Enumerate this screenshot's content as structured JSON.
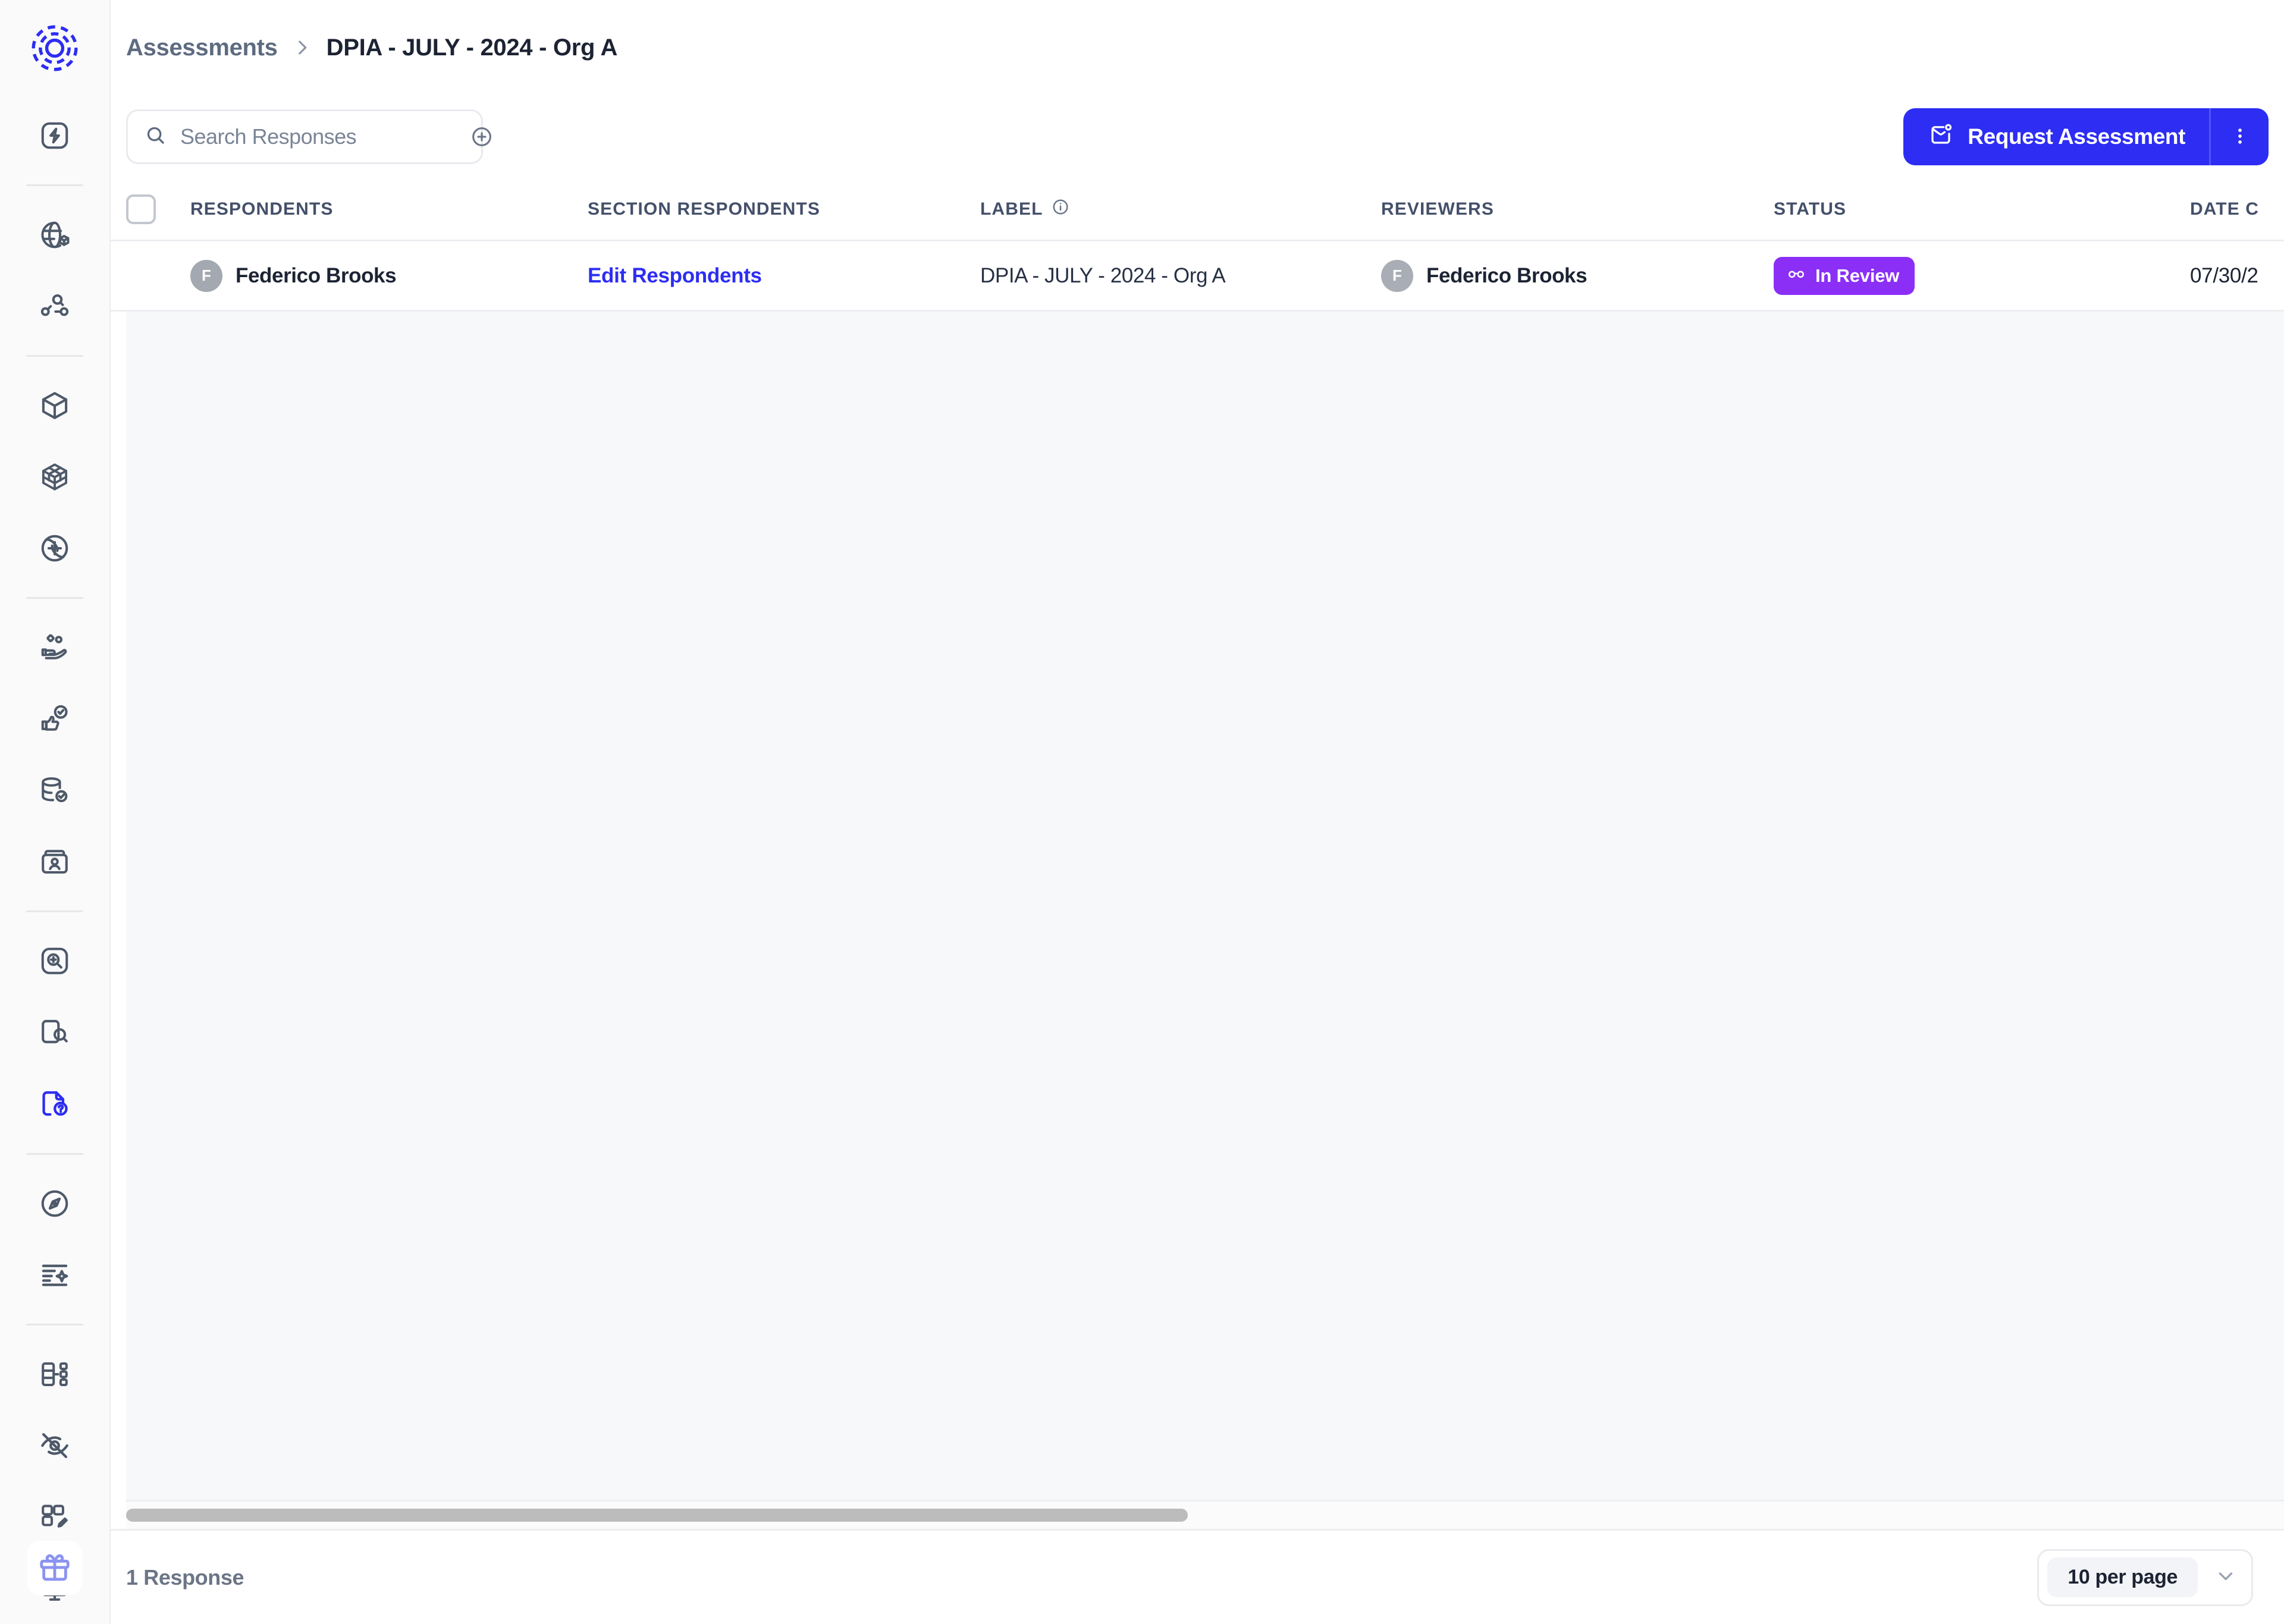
{
  "brand": {
    "logo_icon": "concentric-dashed-circle-logo",
    "accent_blue": "#2d2df3",
    "accent_purple": "#8b2ff7",
    "icon_gray": "#4e5969",
    "gift_color": "#8b93f0"
  },
  "sidebar": {
    "groups": [
      {
        "items": [
          {
            "icon": "lightning-square-icon",
            "name": "sidebar-item-automation",
            "active": false
          }
        ]
      },
      {
        "items": [
          {
            "icon": "globe-box-icon",
            "name": "sidebar-item-global-inventory",
            "active": false
          },
          {
            "icon": "network-search-icon",
            "name": "sidebar-item-data-discovery",
            "active": false
          }
        ]
      },
      {
        "items": [
          {
            "icon": "cube-icon",
            "name": "sidebar-item-assets",
            "active": false
          },
          {
            "icon": "grid-cube-icon",
            "name": "sidebar-item-systems",
            "active": false
          },
          {
            "icon": "globe-network-icon",
            "name": "sidebar-item-vendors",
            "active": false
          }
        ]
      },
      {
        "items": [
          {
            "icon": "hand-data-icon",
            "name": "sidebar-item-data-subjects",
            "active": false
          },
          {
            "icon": "thumbs-up-check-icon",
            "name": "sidebar-item-consent",
            "active": false
          },
          {
            "icon": "database-check-icon",
            "name": "sidebar-item-data-mapping",
            "active": false
          },
          {
            "icon": "contact-card-icon",
            "name": "sidebar-item-records",
            "active": false
          }
        ]
      },
      {
        "items": [
          {
            "icon": "search-zoom-square-icon",
            "name": "sidebar-item-scanning",
            "active": false
          },
          {
            "icon": "document-search-icon",
            "name": "sidebar-item-document-review",
            "active": false
          },
          {
            "icon": "document-question-icon",
            "name": "sidebar-item-assessments",
            "active": true
          }
        ]
      },
      {
        "items": [
          {
            "icon": "compass-icon",
            "name": "sidebar-item-navigator",
            "active": false
          },
          {
            "icon": "list-sparkle-icon",
            "name": "sidebar-item-ai-summary",
            "active": false
          }
        ]
      },
      {
        "items": [
          {
            "icon": "workflow-icon",
            "name": "sidebar-item-workflows",
            "active": false
          },
          {
            "icon": "eye-off-icon",
            "name": "sidebar-item-privacy",
            "active": false
          },
          {
            "icon": "layout-edit-icon",
            "name": "sidebar-item-templates",
            "active": false
          },
          {
            "icon": "code-monitor-icon",
            "name": "sidebar-item-developer",
            "active": false
          }
        ]
      }
    ],
    "bottom": {
      "icon": "gift-icon",
      "name": "whats-new-button"
    }
  },
  "breadcrumb": {
    "parent": "Assessments",
    "separator_icon": "chevron-right-icon",
    "current": "DPIA - JULY - 2024 - Org A"
  },
  "toolbar": {
    "search": {
      "icon": "search-icon",
      "placeholder": "Search Responses",
      "value": "",
      "add_filter_icon": "plus-circle-icon"
    },
    "request_button": {
      "icon": "mail-notification-icon",
      "label": "Request Assessment"
    },
    "kebab_icon": "more-vertical-icon"
  },
  "table": {
    "select_all_checkbox": false,
    "columns": [
      {
        "key": "respondents",
        "label": "RESPONDENTS"
      },
      {
        "key": "section_respondents",
        "label": "SECTION RESPONDENTS"
      },
      {
        "key": "label",
        "label": "LABEL",
        "info_icon": "info-circle-icon"
      },
      {
        "key": "reviewers",
        "label": "REVIEWERS"
      },
      {
        "key": "status",
        "label": "STATUS"
      },
      {
        "key": "date_created",
        "label": "DATE C"
      }
    ],
    "rows": [
      {
        "respondent": {
          "initial": "F",
          "name": "Federico Brooks"
        },
        "section_respondents_link": "Edit Respondents",
        "label": "DPIA - JULY - 2024 - Org A",
        "reviewer": {
          "initial": "F",
          "name": "Federico Brooks"
        },
        "status": {
          "text": "In Review",
          "icon": "glasses-icon",
          "color": "#8b2ff7"
        },
        "date_created": "07/30/2"
      }
    ]
  },
  "footer": {
    "count_label": "1 Response",
    "per_page_value": "10 per page",
    "chevron_icon": "chevron-down-icon"
  }
}
